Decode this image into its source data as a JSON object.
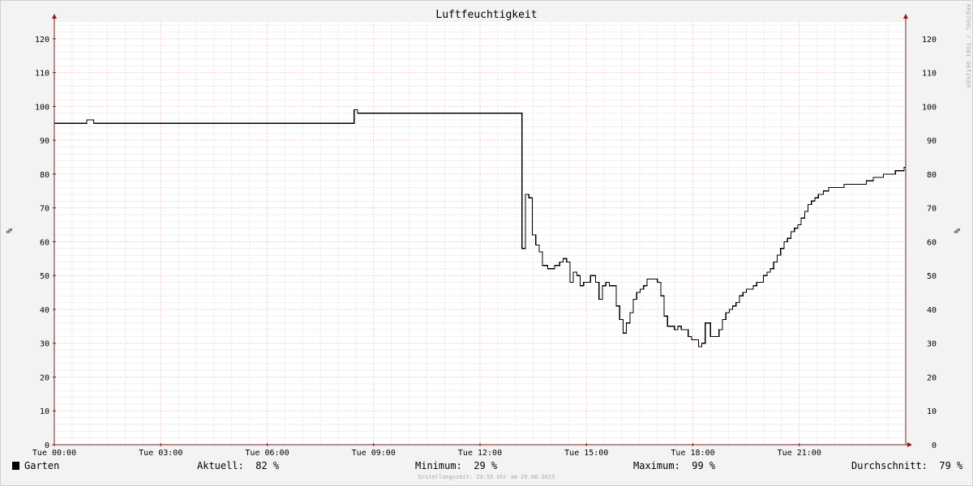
{
  "chart_data": {
    "type": "line",
    "title": "Luftfeuchtigkeit",
    "ylabel": "%",
    "ylabel_right": "%",
    "watermark": "RRDTOOL / TOBI OETIKER",
    "ylim": [
      0,
      125
    ],
    "y_ticks": [
      0,
      10,
      20,
      30,
      40,
      50,
      60,
      70,
      80,
      90,
      100,
      110,
      120
    ],
    "xlim_hours": [
      0,
      24
    ],
    "x_ticks": [
      {
        "hour": 0,
        "label": "Tue 00:00"
      },
      {
        "hour": 3,
        "label": "Tue 03:00"
      },
      {
        "hour": 6,
        "label": "Tue 06:00"
      },
      {
        "hour": 9,
        "label": "Tue 09:00"
      },
      {
        "hour": 12,
        "label": "Tue 12:00"
      },
      {
        "hour": 15,
        "label": "Tue 15:00"
      },
      {
        "hour": 18,
        "label": "Tue 18:00"
      },
      {
        "hour": 21,
        "label": "Tue 21:00"
      }
    ],
    "grid": true,
    "series": [
      {
        "name": "Garten",
        "color": "#000000",
        "step": true,
        "points": [
          [
            0.0,
            95
          ],
          [
            0.95,
            96
          ],
          [
            1.15,
            95
          ],
          [
            8.75,
            99
          ],
          [
            8.85,
            98
          ],
          [
            13.65,
            58
          ],
          [
            13.75,
            74
          ],
          [
            13.85,
            73
          ],
          [
            13.95,
            62
          ],
          [
            14.05,
            59
          ],
          [
            14.15,
            57
          ],
          [
            14.25,
            53
          ],
          [
            14.4,
            52
          ],
          [
            14.6,
            53
          ],
          [
            14.75,
            54
          ],
          [
            14.85,
            55
          ],
          [
            14.95,
            54
          ],
          [
            15.05,
            48
          ],
          [
            15.15,
            51
          ],
          [
            15.25,
            50
          ],
          [
            15.35,
            47
          ],
          [
            15.45,
            48
          ],
          [
            15.55,
            48
          ],
          [
            15.65,
            50
          ],
          [
            15.8,
            48
          ],
          [
            15.9,
            43
          ],
          [
            16.0,
            47
          ],
          [
            16.1,
            48
          ],
          [
            16.2,
            47
          ],
          [
            16.3,
            47
          ],
          [
            16.4,
            41
          ],
          [
            16.5,
            37
          ],
          [
            16.6,
            33
          ],
          [
            16.7,
            36
          ],
          [
            16.8,
            39
          ],
          [
            16.9,
            43
          ],
          [
            17.0,
            45
          ],
          [
            17.1,
            46
          ],
          [
            17.2,
            47
          ],
          [
            17.3,
            49
          ],
          [
            17.5,
            49
          ],
          [
            17.6,
            48
          ],
          [
            17.7,
            44
          ],
          [
            17.8,
            38
          ],
          [
            17.9,
            35
          ],
          [
            18.0,
            35
          ],
          [
            18.1,
            34
          ],
          [
            18.2,
            35
          ],
          [
            18.3,
            34
          ],
          [
            18.5,
            32
          ],
          [
            18.6,
            31
          ],
          [
            18.8,
            29
          ],
          [
            18.9,
            30
          ],
          [
            19.0,
            36
          ],
          [
            19.15,
            32
          ],
          [
            19.3,
            32
          ],
          [
            19.4,
            34
          ],
          [
            19.5,
            37
          ],
          [
            19.6,
            39
          ],
          [
            19.7,
            40
          ],
          [
            19.8,
            41
          ],
          [
            19.9,
            42
          ],
          [
            20.0,
            44
          ],
          [
            20.1,
            45
          ],
          [
            20.2,
            46
          ],
          [
            20.4,
            47
          ],
          [
            20.5,
            48
          ],
          [
            20.7,
            50
          ],
          [
            20.8,
            51
          ],
          [
            20.9,
            52
          ],
          [
            21.0,
            54
          ],
          [
            21.1,
            56
          ],
          [
            21.2,
            58
          ],
          [
            21.3,
            60
          ],
          [
            21.4,
            61
          ],
          [
            21.5,
            63
          ],
          [
            21.6,
            64
          ],
          [
            21.7,
            65
          ],
          [
            21.8,
            67
          ],
          [
            21.9,
            69
          ],
          [
            22.0,
            71
          ],
          [
            22.1,
            72
          ],
          [
            22.2,
            73
          ],
          [
            22.3,
            74
          ],
          [
            22.45,
            75
          ],
          [
            22.6,
            76
          ],
          [
            23.05,
            77
          ],
          [
            23.7,
            78
          ],
          [
            23.9,
            79
          ],
          [
            24.2,
            80
          ],
          [
            24.55,
            81
          ],
          [
            24.8,
            82
          ]
        ]
      }
    ]
  },
  "legend": {
    "name": "Garten",
    "current": "Aktuell:  82 %",
    "minimum": "Minimum:  29 %",
    "maximum": "Maximum:  99 %",
    "average": "Durchschnitt:  79 %"
  },
  "footer": "Erstellungszeit: 23:55 Uhr am 29.08.2023"
}
